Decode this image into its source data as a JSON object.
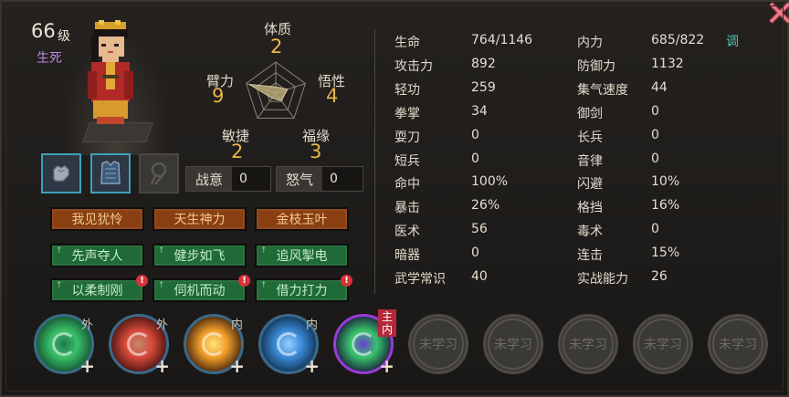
{
  "header": {
    "level": "66",
    "level_unit": "级",
    "title": "生死"
  },
  "radar": {
    "attributes": [
      {
        "label": "体质",
        "value": "2"
      },
      {
        "label": "悟性",
        "value": "4"
      },
      {
        "label": "福缘",
        "value": "3"
      },
      {
        "label": "敏捷",
        "value": "2"
      },
      {
        "label": "臂力",
        "value": "9"
      }
    ],
    "fill_color": "#b8a879"
  },
  "equipment": {
    "icons": [
      "gauntlet-icon",
      "armor-vest-icon",
      "empty-amulet-slot-icon"
    ]
  },
  "combat": {
    "fight_label": "战意",
    "fight_value": "0",
    "rage_label": "怒气",
    "rage_value": "0"
  },
  "traits": [
    {
      "label": "我见犹怜",
      "kind": "innate",
      "warning": false
    },
    {
      "label": "天生神力",
      "kind": "innate",
      "warning": false
    },
    {
      "label": "金枝玉叶",
      "kind": "innate",
      "warning": false
    },
    {
      "label": "先声夺人",
      "kind": "learned",
      "warning": false
    },
    {
      "label": "健步如飞",
      "kind": "learned",
      "warning": false
    },
    {
      "label": "追风掣电",
      "kind": "learned",
      "warning": false
    },
    {
      "label": "以柔制刚",
      "kind": "learned",
      "warning": true
    },
    {
      "label": "伺机而动",
      "kind": "learned",
      "warning": true
    },
    {
      "label": "借力打力",
      "kind": "learned",
      "warning": true
    }
  ],
  "stats_left": [
    {
      "label": "生命",
      "value": "764/1146"
    },
    {
      "label": "攻击力",
      "value": "892"
    },
    {
      "label": "轻功",
      "value": "259"
    },
    {
      "label": "拳掌",
      "value": "34"
    },
    {
      "label": "耍刀",
      "value": "0"
    },
    {
      "label": "短兵",
      "value": "0"
    },
    {
      "label": "命中",
      "value": "100%"
    },
    {
      "label": "暴击",
      "value": "26%"
    },
    {
      "label": "医术",
      "value": "56"
    },
    {
      "label": "暗器",
      "value": "0"
    },
    {
      "label": "武学常识",
      "value": "40"
    }
  ],
  "stats_right": [
    {
      "label": "内力",
      "value": "685/822"
    },
    {
      "label": "防御力",
      "value": "1132"
    },
    {
      "label": "集气速度",
      "value": "44"
    },
    {
      "label": "御剑",
      "value": "0"
    },
    {
      "label": "长兵",
      "value": "0"
    },
    {
      "label": "音律",
      "value": "0"
    },
    {
      "label": "闪避",
      "value": "10%"
    },
    {
      "label": "格挡",
      "value": "16%"
    },
    {
      "label": "毒术",
      "value": "0"
    },
    {
      "label": "连击",
      "value": "15%"
    },
    {
      "label": "实战能力",
      "value": "26"
    }
  ],
  "adjust_label": "调",
  "skills": [
    {
      "tag": "外",
      "icon": "green-orb-palm-icon"
    },
    {
      "tag": "外",
      "icon": "red-fist-icon"
    },
    {
      "tag": "内",
      "icon": "flame-burst-icon"
    },
    {
      "tag": "内",
      "icon": "blue-swirl-icon"
    },
    {
      "tag_top": "主",
      "tag_bottom": "内",
      "icon": "green-vortex-icon"
    }
  ],
  "locked_skill_label": "未学习",
  "locked_count": 5
}
